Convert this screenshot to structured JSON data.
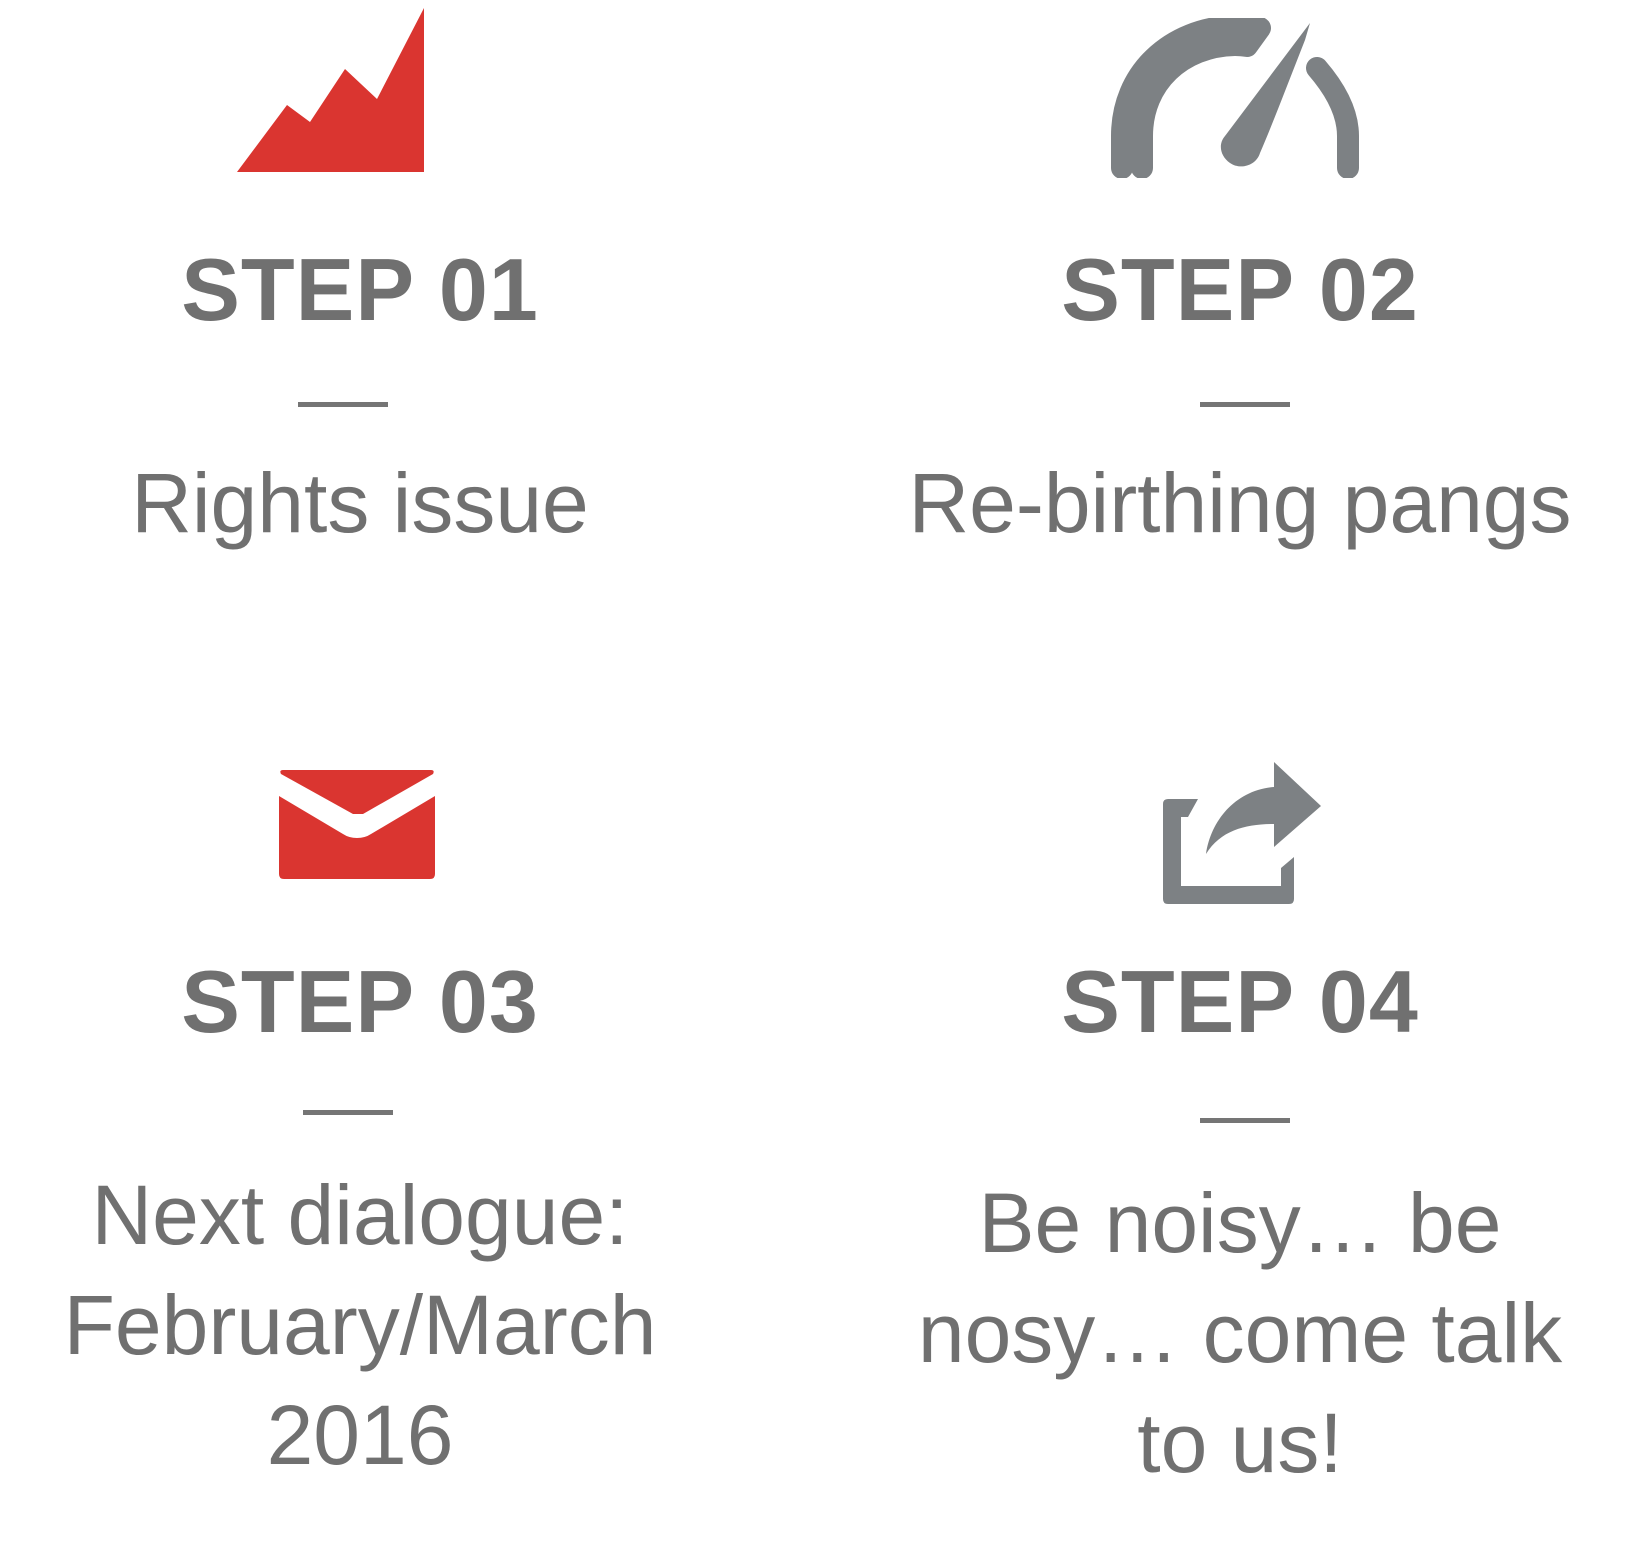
{
  "colors": {
    "red": "#DA3530",
    "gray_icon": "#7D8184",
    "text": "#707070"
  },
  "steps": [
    {
      "title": "STEP 01",
      "description": "Rights issue",
      "icon": "rising-chart-icon"
    },
    {
      "title": "STEP 02",
      "description": "Re-birthing pangs",
      "icon": "speedometer-icon"
    },
    {
      "title": "STEP 03",
      "description_lines": [
        "Next dialogue:",
        "February/March",
        "2016"
      ],
      "icon": "envelope-icon"
    },
    {
      "title": "STEP 04",
      "description_lines": [
        "Be noisy… be",
        "nosy… come talk",
        "to us!"
      ],
      "icon": "share-icon"
    }
  ]
}
